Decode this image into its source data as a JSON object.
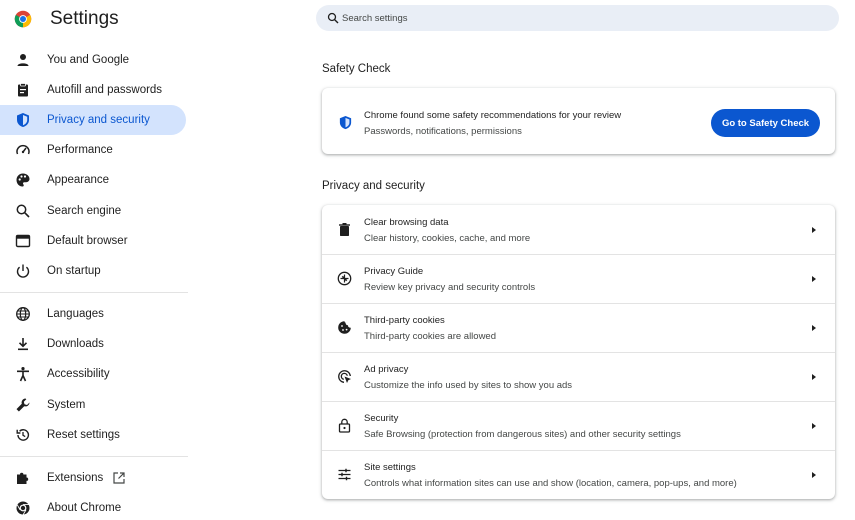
{
  "app": {
    "title": "Settings",
    "logo_icon": "chrome-logo-icon"
  },
  "search": {
    "placeholder": "Search settings",
    "value": ""
  },
  "sidebar": {
    "items": [
      {
        "label": "You and Google",
        "icon": "person-icon",
        "active": false
      },
      {
        "label": "Autofill and passwords",
        "icon": "clipboard-icon",
        "active": false
      },
      {
        "label": "Privacy and security",
        "icon": "shield-icon",
        "active": true
      },
      {
        "label": "Performance",
        "icon": "speedometer-icon",
        "active": false
      },
      {
        "label": "Appearance",
        "icon": "palette-icon",
        "active": false
      },
      {
        "label": "Search engine",
        "icon": "search-icon",
        "active": false
      },
      {
        "label": "Default browser",
        "icon": "browser-window-icon",
        "active": false
      },
      {
        "label": "On startup",
        "icon": "power-icon",
        "active": false
      },
      {
        "label": "Languages",
        "icon": "globe-icon",
        "active": false
      },
      {
        "label": "Downloads",
        "icon": "download-icon",
        "active": false
      },
      {
        "label": "Accessibility",
        "icon": "accessibility-icon",
        "active": false
      },
      {
        "label": "System",
        "icon": "wrench-icon",
        "active": false
      },
      {
        "label": "Reset settings",
        "icon": "history-icon",
        "active": false
      },
      {
        "label": "Extensions",
        "icon": "puzzle-icon",
        "active": false,
        "external_icon": "external-link-icon"
      },
      {
        "label": "About Chrome",
        "icon": "chrome-outline-icon",
        "active": false
      }
    ]
  },
  "safety_check": {
    "section_title": "Safety Check",
    "title": "Chrome found some safety recommendations for your review",
    "subtitle": "Passwords, notifications, permissions",
    "button_label": "Go to Safety Check",
    "icon": "shield-icon"
  },
  "privacy": {
    "section_title": "Privacy and security",
    "rows": [
      {
        "title": "Clear browsing data",
        "subtitle": "Clear history, cookies, cache, and more",
        "icon": "trash-icon"
      },
      {
        "title": "Privacy Guide",
        "subtitle": "Review key privacy and security controls",
        "icon": "compass-plus-icon"
      },
      {
        "title": "Third-party cookies",
        "subtitle": "Third-party cookies are allowed",
        "icon": "cookie-icon"
      },
      {
        "title": "Ad privacy",
        "subtitle": "Customize the info used by sites to show you ads",
        "icon": "ad-target-icon"
      },
      {
        "title": "Security",
        "subtitle": "Safe Browsing (protection from dangerous sites) and other security settings",
        "icon": "lock-icon"
      },
      {
        "title": "Site settings",
        "subtitle": "Controls what information sites can use and show (location, camera, pop-ups, and more)",
        "icon": "sliders-icon"
      }
    ]
  },
  "colors": {
    "accent": "#0b57d0",
    "active_nav_bg": "#d3e3fd",
    "search_bg": "#e9eef6",
    "text_primary": "#1f1f1f",
    "text_secondary": "#444746"
  }
}
